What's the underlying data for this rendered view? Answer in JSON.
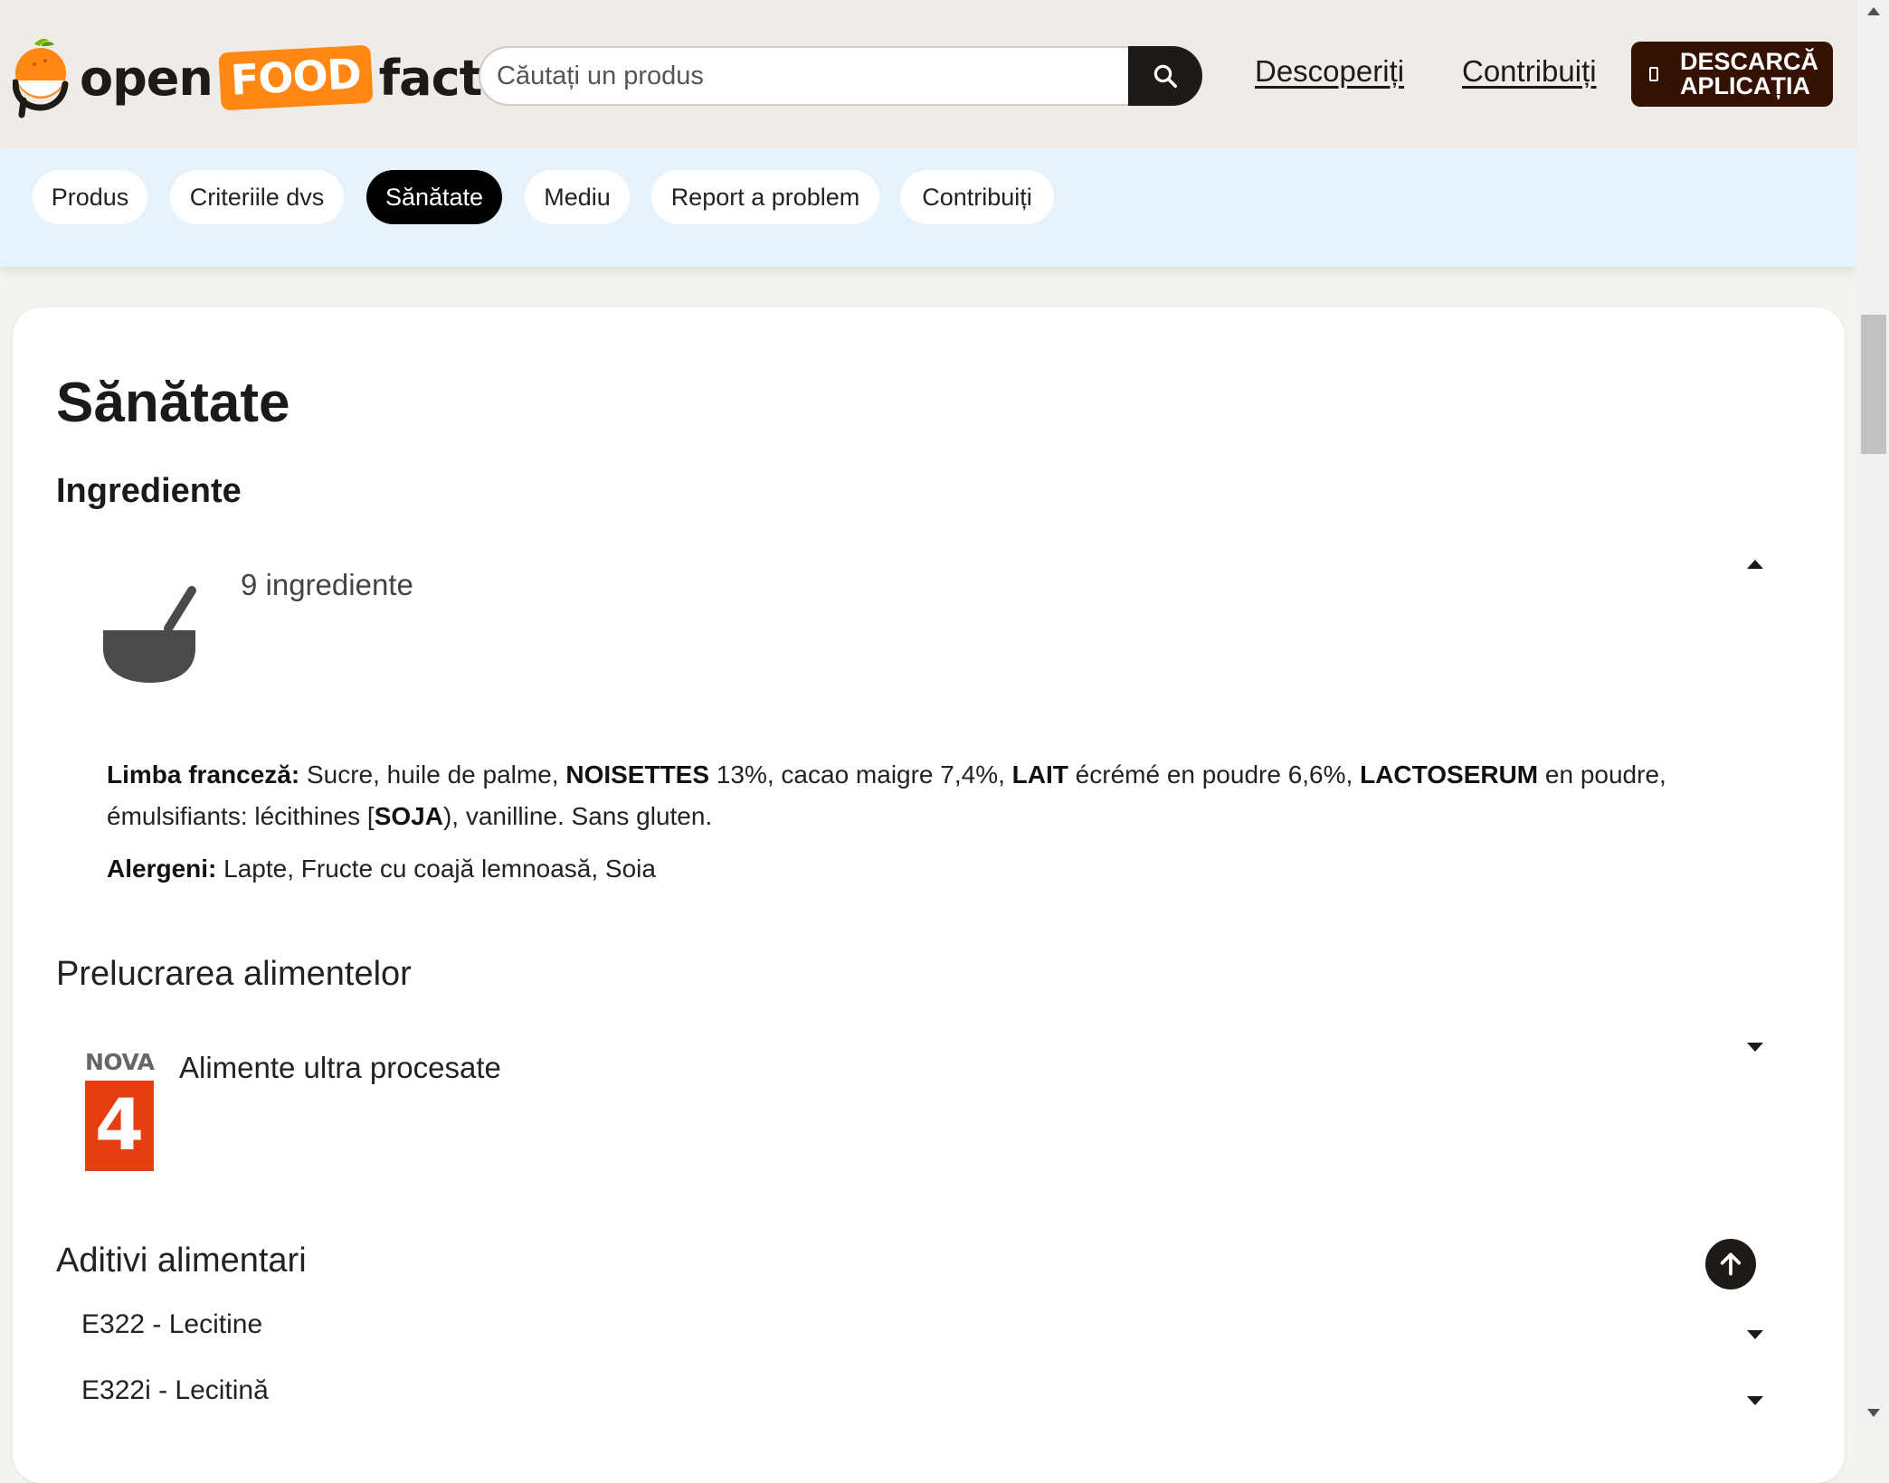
{
  "header": {
    "logo": {
      "part1": "open",
      "part2": "FOOD",
      "part3": "facts"
    },
    "search_placeholder": "Căutați un produs",
    "nav": {
      "discover": "Descoperiți",
      "contribute": "Contribuiți"
    },
    "download_label": "DESCARCĂ APLICAȚIA"
  },
  "tabs": [
    {
      "label": "Produs",
      "active": false
    },
    {
      "label": "Criteriile dvs",
      "active": false
    },
    {
      "label": "Sănătate",
      "active": true
    },
    {
      "label": "Mediu",
      "active": false
    },
    {
      "label": "Report a problem",
      "active": false
    },
    {
      "label": "Contribuiți",
      "active": false
    }
  ],
  "main": {
    "title": "Sănătate",
    "ingredients": {
      "heading": "Ingrediente",
      "summary": "9 ingrediente",
      "language_label": "Limba franceză:",
      "parts": [
        {
          "t": "Sucre, huile de palme, "
        },
        {
          "t": "NOISETTES",
          "b": true
        },
        {
          "t": " 13%, cacao maigre 7,4%, "
        },
        {
          "t": "LAIT",
          "b": true
        },
        {
          "t": " écrémé en poudre 6,6%, "
        },
        {
          "t": "LACTOSERUM",
          "b": true
        },
        {
          "t": " en poudre, émulsifiants: lécithines ["
        },
        {
          "t": "SOJA",
          "b": true
        },
        {
          "t": "), vanilline. Sans gluten."
        }
      ],
      "allergens_label": "Alergeni:",
      "allergens": "Lapte, Fructe cu coajă lemnoasă, Soia"
    },
    "processing": {
      "heading": "Prelucrarea alimentelor",
      "nova_label": "NOVA",
      "nova_value": "4",
      "description": "Alimente ultra procesate"
    },
    "additives": {
      "heading": "Aditivi alimentari",
      "items": [
        "E322 - Lecitine",
        "E322i - Lecitină"
      ]
    }
  },
  "colors": {
    "header_bg": "#efebe6",
    "tabbar_bg": "#e6f3fc",
    "brand_orange": "#ff8714",
    "dark": "#201a17",
    "nova4_red": "#e63e11"
  },
  "icons": [
    "search-icon",
    "phone-icon",
    "bowl-icon",
    "chevron-up-icon",
    "chevron-down-icon",
    "arrow-up-icon"
  ]
}
